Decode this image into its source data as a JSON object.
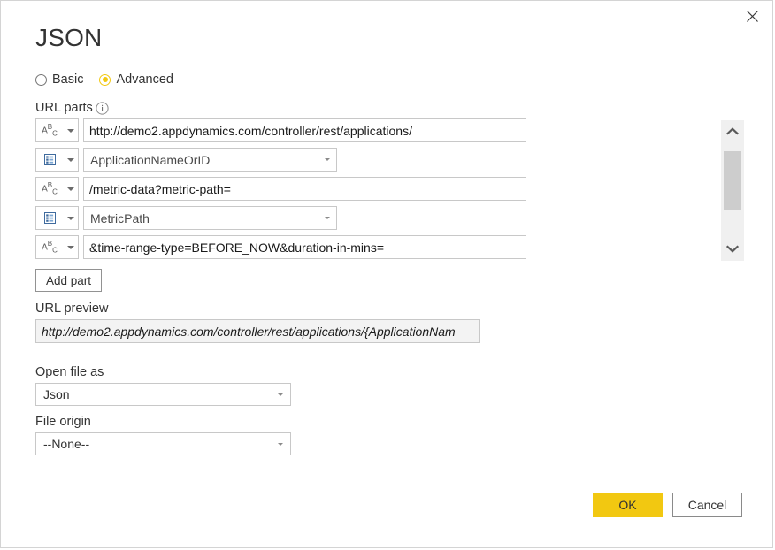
{
  "dialog": {
    "title": "JSON",
    "close_label": "Close"
  },
  "mode": {
    "options": [
      {
        "label": "Basic",
        "selected": false
      },
      {
        "label": "Advanced",
        "selected": true
      }
    ]
  },
  "url_parts": {
    "label": "URL parts",
    "info_icon": "info-icon",
    "rows": [
      {
        "type_icon": "abc-text-icon",
        "kind": "text",
        "value": "http://demo2.appdynamics.com/controller/rest/applications/"
      },
      {
        "type_icon": "parameter-list-icon",
        "kind": "parameter",
        "value": "ApplicationNameOrID"
      },
      {
        "type_icon": "abc-text-icon",
        "kind": "text",
        "value": "/metric-data?metric-path="
      },
      {
        "type_icon": "parameter-list-icon",
        "kind": "parameter",
        "value": "MetricPath"
      },
      {
        "type_icon": "abc-text-icon",
        "kind": "text",
        "value": "&time-range-type=BEFORE_NOW&duration-in-mins="
      }
    ],
    "add_part_label": "Add part"
  },
  "url_preview": {
    "label": "URL preview",
    "value": "http://demo2.appdynamics.com/controller/rest/applications/{ApplicationNam"
  },
  "open_file_as": {
    "label": "Open file as",
    "value": "Json"
  },
  "file_origin": {
    "label": "File origin",
    "value": "--None--"
  },
  "scrollbar": {
    "up_icon": "chevron-up-icon",
    "down_icon": "chevron-down-icon"
  },
  "footer": {
    "ok_label": "OK",
    "cancel_label": "Cancel"
  },
  "colors": {
    "accent": "#f2c811",
    "text": "#333333",
    "border": "#c8c8c8",
    "preview_bg": "#f3f3f3",
    "icon_blue": "#3f6b9e"
  }
}
